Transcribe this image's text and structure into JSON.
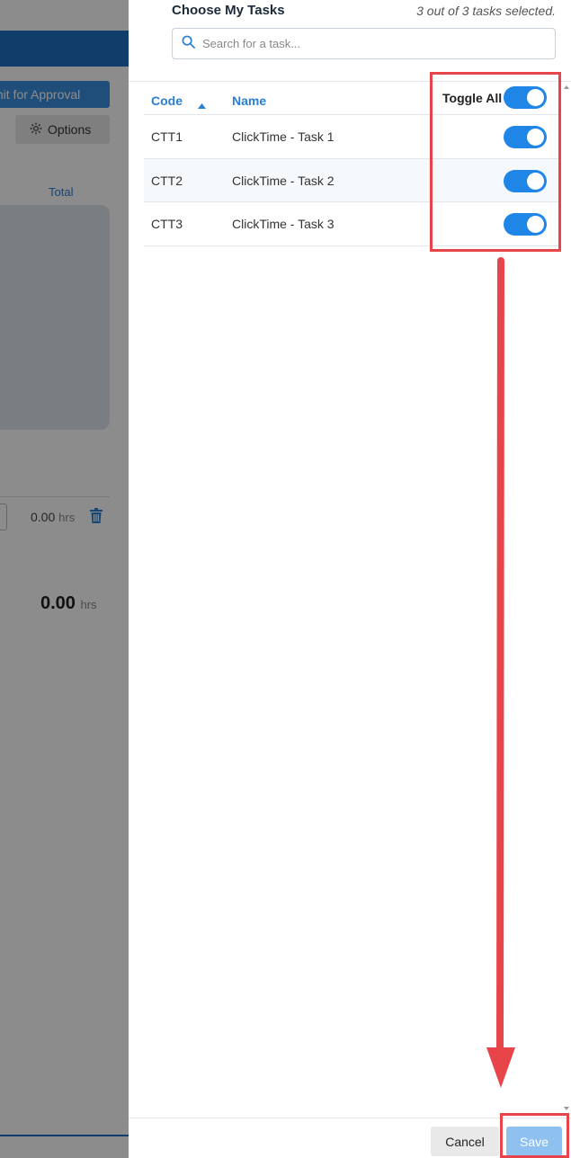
{
  "background": {
    "submit_label": "mit for Approval",
    "options_label": "Options",
    "total_header": "Total",
    "row_hours": "0.00",
    "total_hours": "0.00",
    "hours_unit": "hrs"
  },
  "drawer": {
    "title": "Choose My Tasks",
    "selection_count": "3 out of 3 tasks selected.",
    "search": {
      "placeholder": "Search for a task...",
      "value": ""
    },
    "columns": {
      "code": "Code",
      "name": "Name",
      "toggle_all": "Toggle All"
    },
    "sort": {
      "column": "code",
      "direction": "ascending"
    },
    "toggle_all_on": true,
    "tasks": [
      {
        "code": "CTT1",
        "name": "ClickTime - Task 1",
        "selected": true
      },
      {
        "code": "CTT2",
        "name": "ClickTime - Task 2",
        "selected": true
      },
      {
        "code": "CTT3",
        "name": "ClickTime - Task 3",
        "selected": true
      }
    ],
    "footer": {
      "cancel_label": "Cancel",
      "save_label": "Save"
    }
  },
  "colors": {
    "accent": "#1f86e8",
    "link": "#2a7fd4",
    "save_disabled": "#8fc1f0",
    "annotation": "#e8454a",
    "header_bar": "#1e6fbf"
  },
  "icons": [
    "search-icon",
    "sort-ascending-icon",
    "gear-icon",
    "trash-icon"
  ]
}
